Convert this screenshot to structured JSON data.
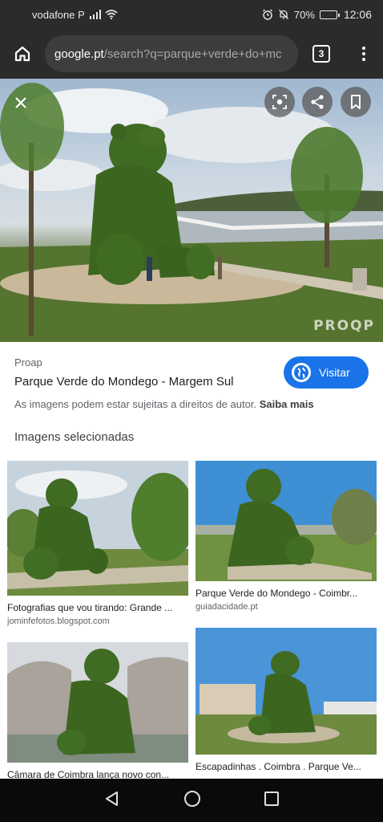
{
  "status_bar": {
    "carrier": "vodafone P",
    "battery": "70%",
    "battery_level": 0.7,
    "time": "12:06"
  },
  "browser": {
    "url_host": "google.pt",
    "url_path": "/search?q=parque+verde+do+mc",
    "tab_count": "3"
  },
  "hero": {
    "watermark": "PROQP"
  },
  "result": {
    "source": "Proap",
    "title": "Parque Verde do Mondego - Margem Sul",
    "visit_label": "Visitar",
    "rights_text": "As imagens podem estar sujeitas a direitos de autor.",
    "learn_more": "Saiba mais"
  },
  "related": {
    "heading": "Imagens selecionadas",
    "items": [
      {
        "caption": "Fotografias que vou tirando: Grande ...",
        "domain": "jominfefotos.blogspot.com"
      },
      {
        "caption": "Parque Verde do Mondego - Coimbr...",
        "domain": "guiadacidade.pt"
      },
      {
        "caption": "Câmara de Coimbra lança novo con...",
        "domain": ""
      },
      {
        "caption": "Escapadinhas . Coimbra . Parque Ve...",
        "domain": ""
      }
    ]
  },
  "colors": {
    "accent": "#1a73e8",
    "chrome_dark": "#2b2b2b",
    "topiary_green": "#3f6b22"
  }
}
